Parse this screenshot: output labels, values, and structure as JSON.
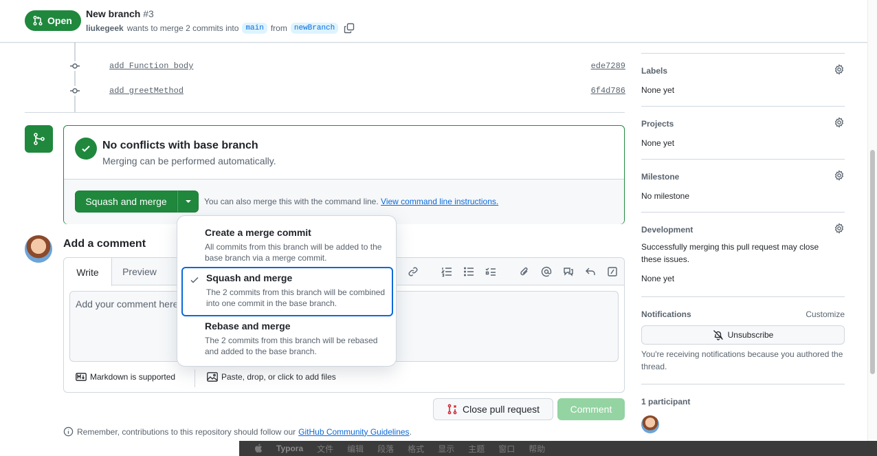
{
  "header": {
    "state": "Open",
    "title": "New branch",
    "number": "#3",
    "author": "liukegeek",
    "merge_text": "wants to merge 2 commits into",
    "base_branch": "main",
    "from_text": "from",
    "head_branch": "newBranch"
  },
  "commits": [
    {
      "message": "add Function body",
      "sha": "ede7289"
    },
    {
      "message": "add greetMethod",
      "sha": "6f4d786"
    }
  ],
  "merge_box": {
    "title": "No conflicts with base branch",
    "subtitle": "Merging can be performed automatically.",
    "button": "Squash and merge",
    "alt_text": "You can also merge this with the command line.",
    "alt_link": "View command line instructions."
  },
  "dropdown": {
    "items": [
      {
        "title": "Create a merge commit",
        "desc": "All commits from this branch will be added to the base branch via a merge commit."
      },
      {
        "title": "Squash and merge",
        "desc": "The 2 commits from this branch will be combined into one commit in the base branch."
      },
      {
        "title": "Rebase and merge",
        "desc": "The 2 commits from this branch will be rebased and added to the base branch."
      }
    ]
  },
  "comment": {
    "title": "Add a comment",
    "tab_write": "Write",
    "tab_preview": "Preview",
    "placeholder": "Add your comment here...",
    "markdown": "Markdown is supported",
    "paste": "Paste, drop, or click to add files",
    "close_button": "Close pull request",
    "comment_button": "Comment",
    "guidelines_text": "Remember, contributions to this repository should follow our",
    "guidelines_link": "GitHub Community Guidelines",
    "guidelines_end": "."
  },
  "sidebar": {
    "labels": {
      "head": "Labels",
      "value": "None yet"
    },
    "projects": {
      "head": "Projects",
      "value": "None yet"
    },
    "milestone": {
      "head": "Milestone",
      "value": "No milestone"
    },
    "development": {
      "head": "Development",
      "value": "Successfully merging this pull request may close these issues.",
      "value2": "None yet"
    },
    "notifications": {
      "head": "Notifications",
      "customize": "Customize",
      "button": "Unsubscribe",
      "note": "You're receiving notifications because you authored the thread."
    },
    "participants": {
      "head": "1 participant"
    }
  },
  "menubar": {
    "items": [
      "Typora",
      "文件",
      "编辑",
      "段落",
      "格式",
      "显示",
      "主题",
      "窗口",
      "帮助"
    ]
  },
  "colors": {
    "green": "#1f883d",
    "blue": "#0969da",
    "muted": "#59636e"
  }
}
